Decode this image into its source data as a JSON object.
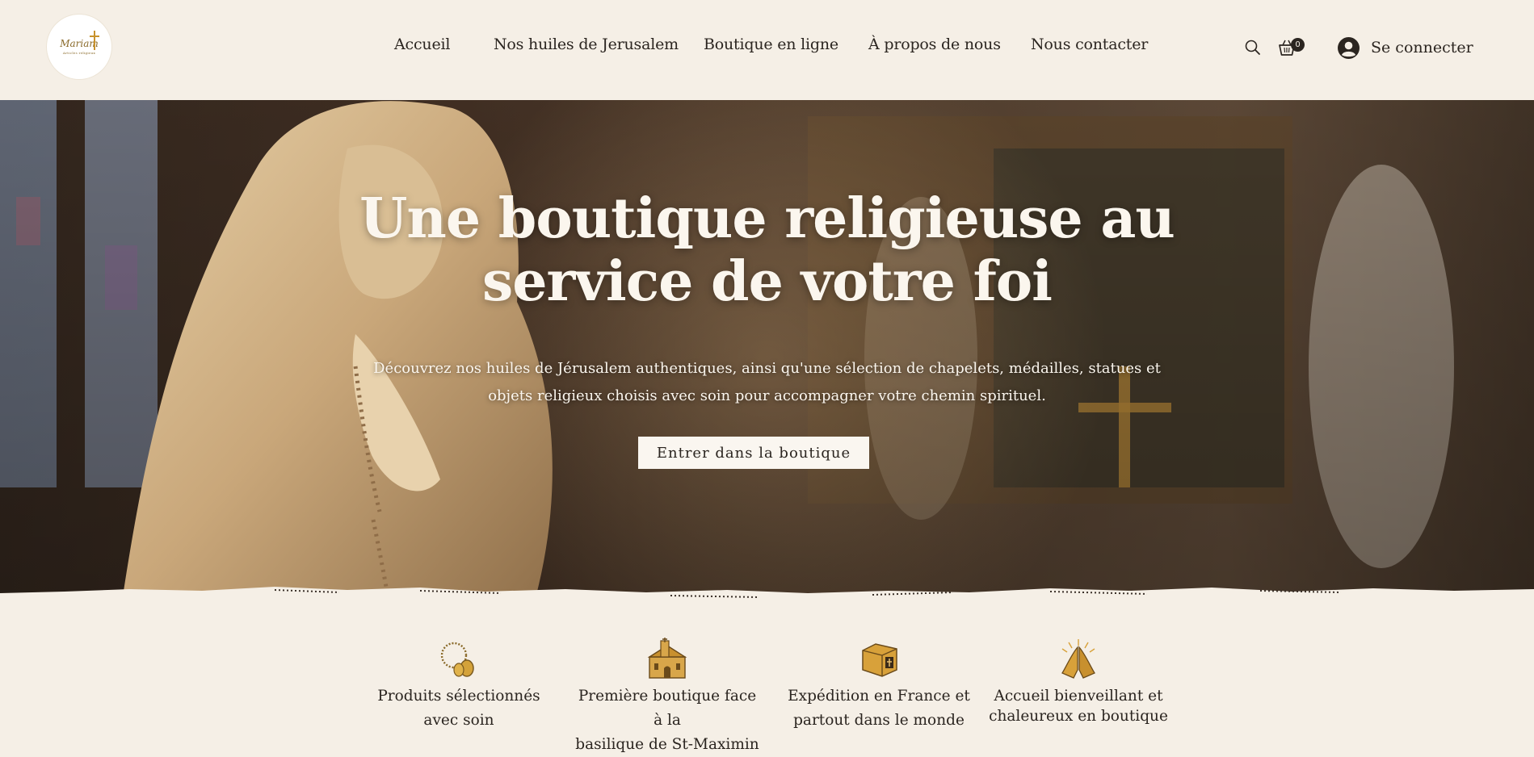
{
  "header": {
    "logo": {
      "name": "Mariam",
      "tagline": "Articles religieux",
      "icon": "cross-icon"
    },
    "nav": [
      "Accueil",
      "Nos huiles de Jerusalem",
      "Boutique en ligne",
      "À propos de nous",
      "Nous contacter"
    ],
    "search_icon": "search-icon",
    "cart": {
      "icon": "basket-icon",
      "count": "0"
    },
    "login": {
      "icon": "user-avatar-icon",
      "label": "Se connecter"
    }
  },
  "hero": {
    "title_lines": [
      "Une boutique religieuse au",
      "service de votre foi"
    ],
    "subtitle_lines": [
      "Découvrez nos huiles de Jérusalem authentiques, ainsi qu'une sélection de chapelets, médailles, statues et",
      "objets religieux choisis avec soin pour accompagner votre chemin spirituel."
    ],
    "cta": "Entrer dans la boutique"
  },
  "features": [
    {
      "icon": "rosary-icon",
      "lines": [
        "Produits sélectionnés",
        "avec soin"
      ]
    },
    {
      "icon": "church-icon",
      "lines": [
        "Première boutique face à la",
        "basilique de St-Maximin"
      ]
    },
    {
      "icon": "package-icon",
      "lines": [
        "Expédition en France et",
        "partout dans le monde"
      ]
    },
    {
      "icon": "praying-hands-icon",
      "lines": [
        "Accueil bienveillant et",
        "chaleureux en boutique"
      ]
    }
  ],
  "colors": {
    "background": "#f5efe6",
    "text": "#2b2520",
    "gold": "#c8922c",
    "hero_text": "#fbf6ee"
  }
}
